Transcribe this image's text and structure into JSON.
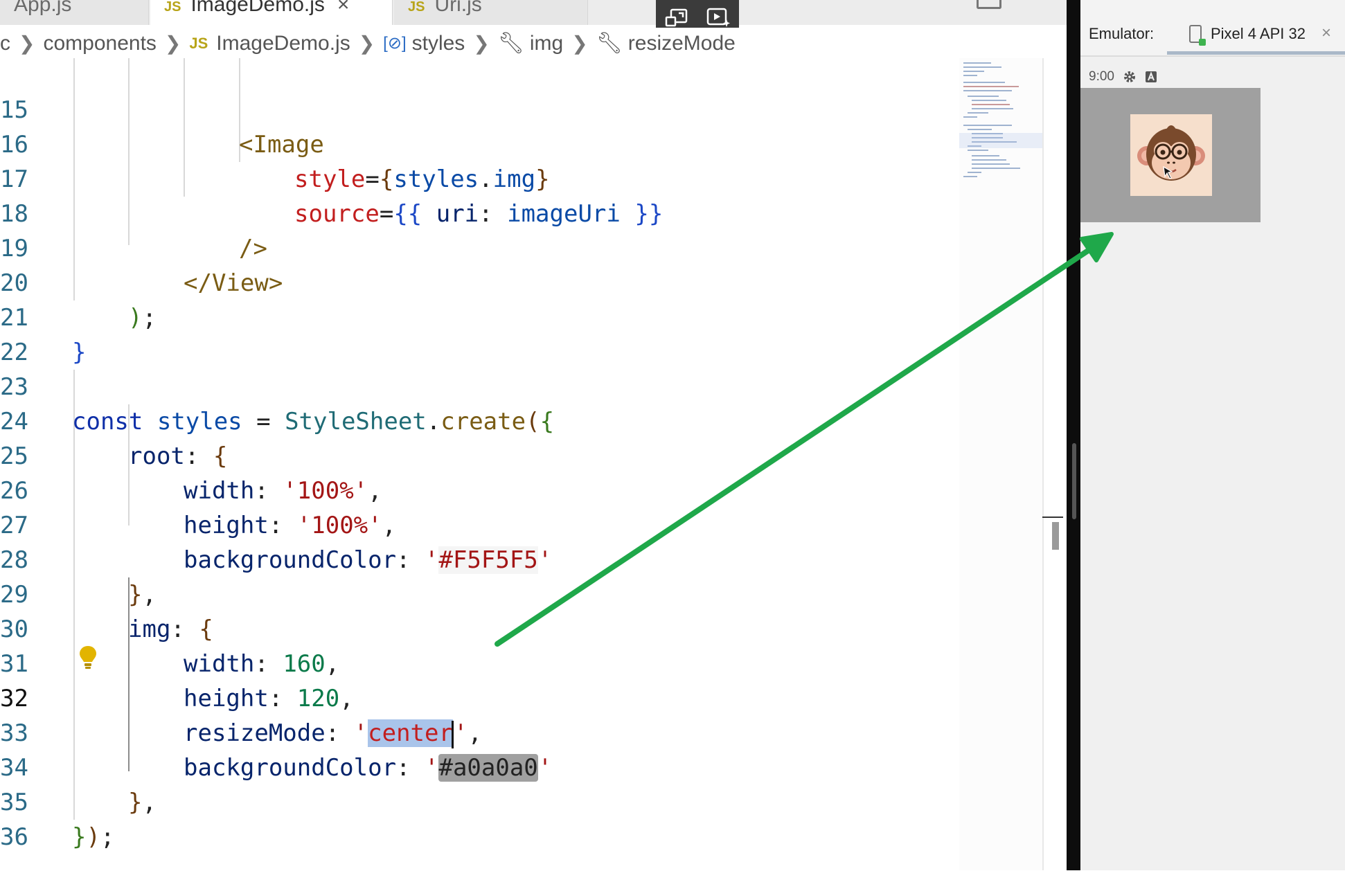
{
  "tabs": [
    {
      "label": "App.js",
      "active": false
    },
    {
      "label": "ImageDemo.js",
      "active": true,
      "close": "×"
    },
    {
      "label": "Uri.js",
      "active": false
    }
  ],
  "breadcrumb": {
    "items": [
      "c",
      "components",
      "ImageDemo.js",
      "styles",
      "img",
      "resizeMode"
    ]
  },
  "editor": {
    "line_numbers": [
      "15",
      "16",
      "17",
      "18",
      "19",
      "20",
      "21",
      "22",
      "23",
      "24",
      "25",
      "26",
      "27",
      "28",
      "29",
      "30",
      "31",
      "32",
      "33",
      "34",
      "35",
      "36"
    ],
    "current_line": "32",
    "tokens": {
      "l15_tag": "<Image",
      "l16_attr": "style",
      "l16_eq": "=",
      "l16_br_open": "{",
      "l16_val": "styles",
      "l16_dot": ".",
      "l16_prop": "img",
      "l16_br_close": "}",
      "l17_attr": "source",
      "l17_eq": "=",
      "l17_br_open": "{{",
      "l17_key": " uri",
      "l17_colon": ": ",
      "l17_val": "imageUri",
      "l17_br_close": " }}",
      "l18_close": "/>",
      "l19_tag": "</View>",
      "l20_paren": ")",
      "l20_semi": ";",
      "l21_brace": "}",
      "l23_const": "const",
      "l23_var": " styles",
      "l23_eq": " = ",
      "l23_cls": "StyleSheet",
      "l23_dot": ".",
      "l23_fn": "create",
      "l23_paren": "(",
      "l23_brace": "{",
      "l24_key": "root",
      "l24_colon": ": ",
      "l24_brace": "{",
      "l25_key": "width",
      "l25_colon": ": ",
      "l25_val": "'100%'",
      "l25_comma": ",",
      "l26_key": "height",
      "l26_colon": ": ",
      "l26_val": "'100%'",
      "l26_comma": ",",
      "l27_key": "backgroundColor",
      "l27_colon": ": ",
      "l27_q1": "'",
      "l27_val": "#F5F5F5",
      "l27_q2": "'",
      "l28_brace": "}",
      "l28_comma": ",",
      "l29_key": "img",
      "l29_colon": ": ",
      "l29_brace": "{",
      "l30_key": "width",
      "l30_colon": ": ",
      "l30_val": "160",
      "l30_comma": ",",
      "l31_key": "height",
      "l31_colon": ": ",
      "l31_val": "120",
      "l31_comma": ",",
      "l32_key": "resizeMode",
      "l32_colon": ": ",
      "l32_q1": "'",
      "l32_val": "center",
      "l32_q2": "'",
      "l32_comma": ",",
      "l33_key": "backgroundColor",
      "l33_colon": ": ",
      "l33_q1": "'",
      "l33_val": "#a0a0a0",
      "l33_q2": "'",
      "l34_brace": "}",
      "l34_comma": ",",
      "l35_brace": "}",
      "l35_paren": ")",
      "l35_semi": ";"
    }
  },
  "emulator": {
    "label": "Emulator:",
    "device": "Pixel 4 API 32",
    "close": "×",
    "time": "9:00",
    "screen_bg": "#a0a0a0",
    "image_bg": "#f6dfcc"
  },
  "annotation": {
    "arrow_color": "#1fa84a"
  }
}
